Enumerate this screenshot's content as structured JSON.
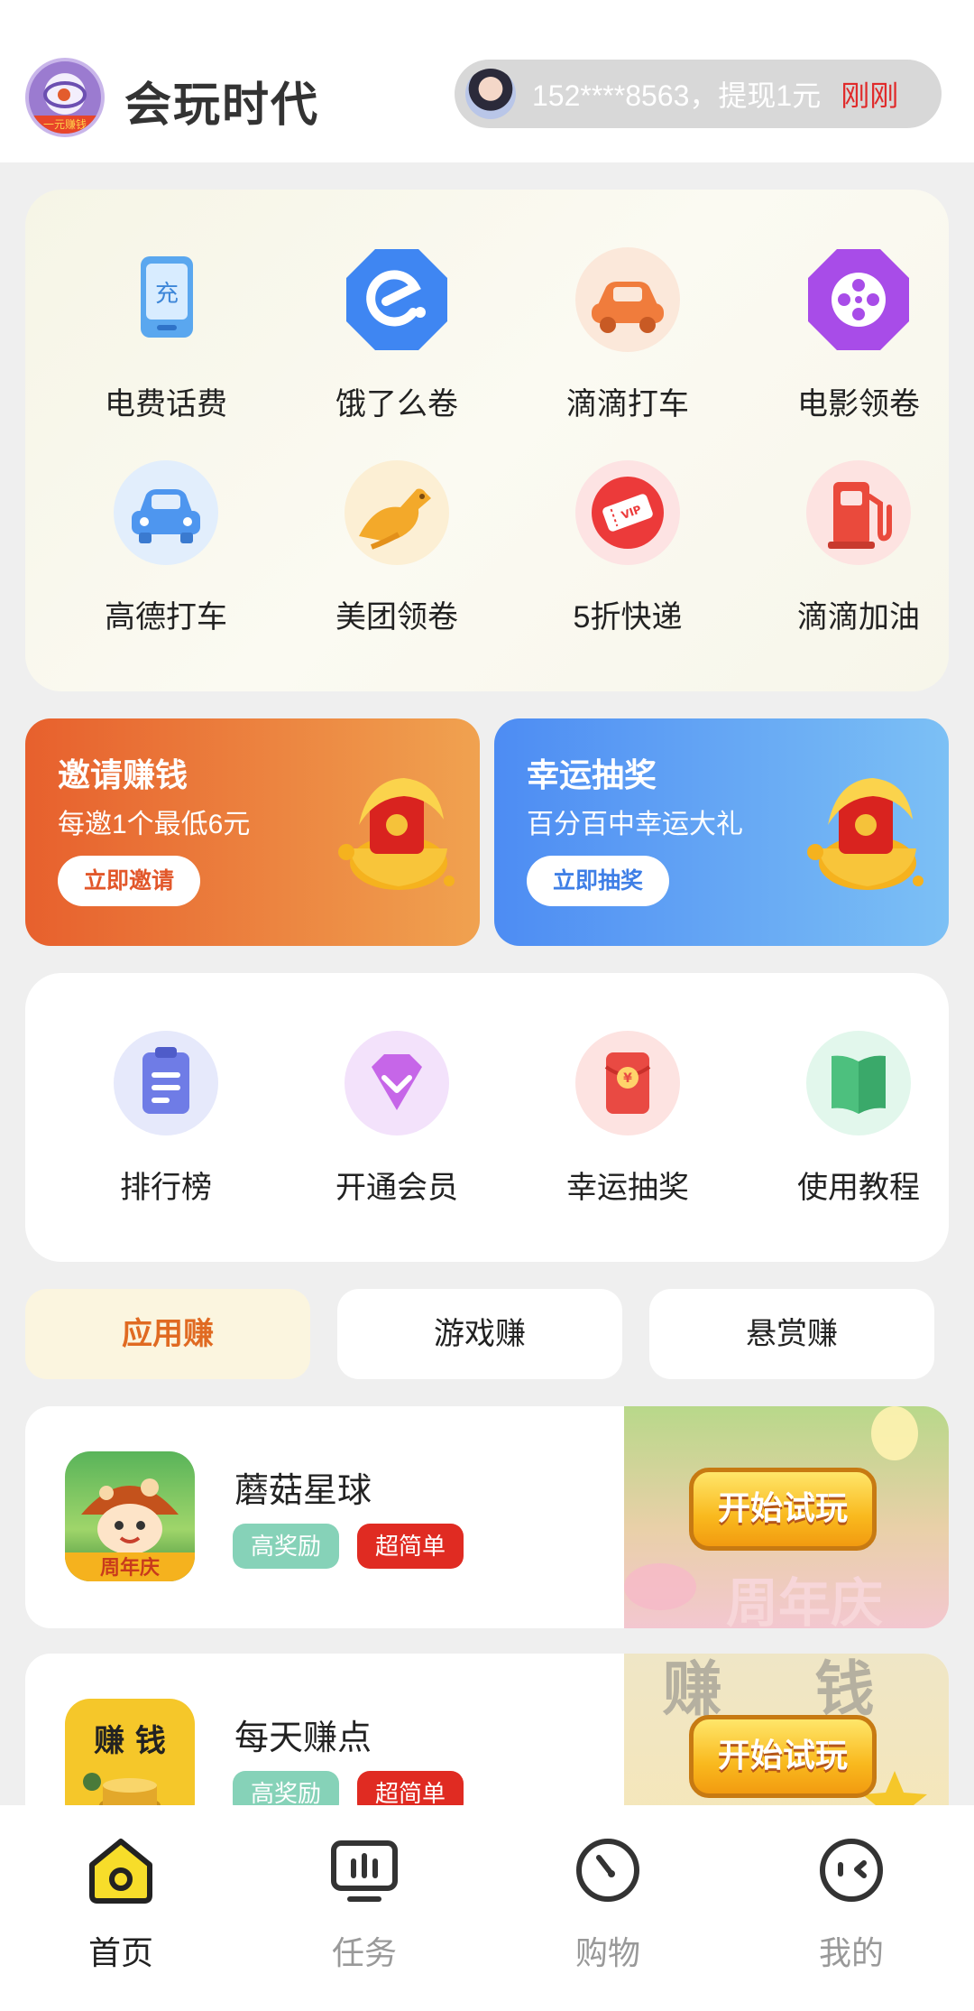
{
  "header": {
    "app_title": "会玩时代",
    "logo_text": "一元赚钱",
    "ticker_text": "152****8563，提现1元",
    "ticker_time": "刚刚"
  },
  "services": [
    {
      "label": "电费话费",
      "icon": "recharge-icon"
    },
    {
      "label": "饿了么卷",
      "icon": "eleme-icon"
    },
    {
      "label": "滴滴打车",
      "icon": "car-icon"
    },
    {
      "label": "电影领卷",
      "icon": "film-reel-icon"
    },
    {
      "label": "高德打车",
      "icon": "car-icon"
    },
    {
      "label": "美团领卷",
      "icon": "kangaroo-icon"
    },
    {
      "label": "5折快递",
      "icon": "vip-ticket-icon"
    },
    {
      "label": "滴滴加油",
      "icon": "fuel-pump-icon"
    }
  ],
  "promos": {
    "invite": {
      "title": "邀请赚钱",
      "subtitle": "每邀1个最低6元",
      "button": "立即邀请"
    },
    "lottery": {
      "title": "幸运抽奖",
      "subtitle": "百分百中幸运大礼",
      "button": "立即抽奖"
    }
  },
  "features": [
    {
      "label": "排行榜",
      "icon": "clipboard-icon"
    },
    {
      "label": "开通会员",
      "icon": "diamond-icon"
    },
    {
      "label": "幸运抽奖",
      "icon": "red-envelope-icon"
    },
    {
      "label": "使用教程",
      "icon": "book-icon"
    }
  ],
  "tabs": [
    {
      "label": "应用赚",
      "active": true
    },
    {
      "label": "游戏赚",
      "active": false
    },
    {
      "label": "悬赏赚",
      "active": false
    }
  ],
  "apps": [
    {
      "name": "蘑菇星球",
      "tags": [
        "高奖励",
        "超简单"
      ],
      "icon_text": "周年庆",
      "banner_text": "周年庆",
      "button": "开始试玩"
    },
    {
      "name": "每天赚点",
      "tags": [
        "高奖励",
        "超简单"
      ],
      "icon_text": "赚 钱",
      "banner_text": "赚 钱",
      "button": "开始试玩"
    }
  ],
  "nav": [
    {
      "label": "首页",
      "active": true
    },
    {
      "label": "任务",
      "active": false
    },
    {
      "label": "购物",
      "active": false
    },
    {
      "label": "我的",
      "active": false
    }
  ],
  "colors": {
    "accent_orange": "#e06a22",
    "tag_green": "#86d2b8",
    "tag_red": "#e02b22",
    "highlight_red": "#e02a2a"
  }
}
